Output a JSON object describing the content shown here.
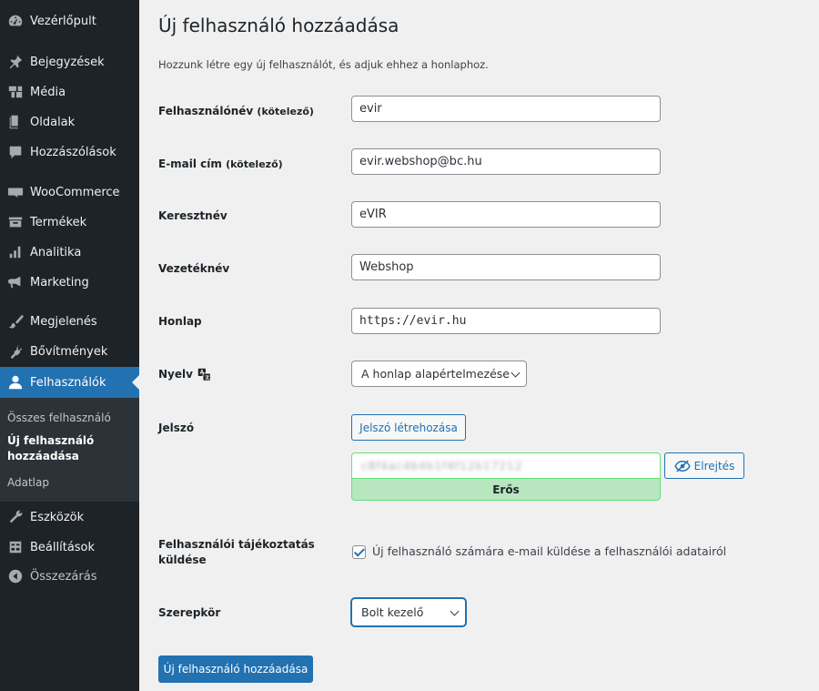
{
  "sidebar": {
    "items": [
      {
        "label": "Vezérlőpult",
        "icon": "dashboard-icon"
      },
      {
        "label": "Bejegyzések",
        "icon": "pin-icon"
      },
      {
        "label": "Média",
        "icon": "media-icon"
      },
      {
        "label": "Oldalak",
        "icon": "page-icon"
      },
      {
        "label": "Hozzászólások",
        "icon": "comment-icon"
      },
      {
        "label": "WooCommerce",
        "icon": "woocommerce-icon"
      },
      {
        "label": "Termékek",
        "icon": "archive-icon"
      },
      {
        "label": "Analitika",
        "icon": "bar-chart-icon"
      },
      {
        "label": "Marketing",
        "icon": "megaphone-icon"
      },
      {
        "label": "Megjelenés",
        "icon": "brush-icon"
      },
      {
        "label": "Bővítmények",
        "icon": "plug-icon"
      },
      {
        "label": "Felhasználók",
        "icon": "users-icon"
      },
      {
        "label": "Eszközök",
        "icon": "wrench-icon"
      },
      {
        "label": "Beállítások",
        "icon": "settings-icon"
      },
      {
        "label": "Összezárás",
        "icon": "collapse-icon"
      }
    ],
    "submenu": {
      "all_users": "Összes felhasználó",
      "add_new_line1": "Új felhasználó",
      "add_new_line2": "hozzáadása",
      "profile": "Adatlap"
    },
    "accent": "#2271b1"
  },
  "page": {
    "title": "Új felhasználó hozzáadása",
    "intro": "Hozzunk létre egy új felhasználót, és adjuk ehhez a honlaphoz."
  },
  "form": {
    "username": {
      "label": "Felhasználónév",
      "required": "(kötelező)",
      "value": "evir"
    },
    "email": {
      "label": "E-mail cím",
      "required": "(kötelező)",
      "value": "evir.webshop@bc.hu"
    },
    "first_name": {
      "label": "Keresztnév",
      "value": "eVIR"
    },
    "last_name": {
      "label": "Vezetéknév",
      "value": "Webshop"
    },
    "website": {
      "label": "Honlap",
      "value": "https://evir.hu"
    },
    "language": {
      "label": "Nyelv",
      "value": "A honlap alapértelmezése"
    },
    "password": {
      "label": "Jelszó",
      "generate_button": "Jelszó létrehozása",
      "value": "c8f4ac4b4b1f4f12b17212",
      "hide_button": "Elrejtés",
      "strength": "Erős"
    },
    "notification": {
      "label_line1": "Felhasználói tájékoztatás",
      "label_line2": "küldése",
      "checkbox_label": "Új felhasználó számára e-mail küldése a felhasználói adatairól",
      "checked": true
    },
    "role": {
      "label": "Szerepkör",
      "value": "Bolt kezelő"
    },
    "submit": "Új felhasználó hozzáadása"
  }
}
